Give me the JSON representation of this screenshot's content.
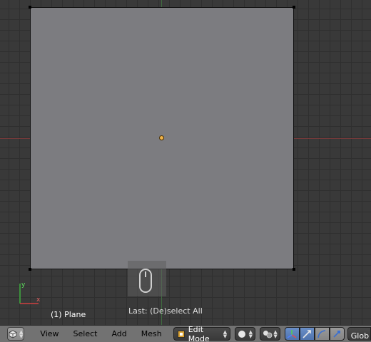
{
  "viewport": {
    "object_info": "(1) Plane",
    "last_operator": "Last: (De)select All",
    "nav_axis_x": "x",
    "nav_axis_y": "y"
  },
  "header": {
    "menus": [
      "View",
      "Select",
      "Add",
      "Mesh"
    ],
    "mode": "Edit Mode",
    "orientation": "Glob"
  },
  "colors": {
    "plane": "#7c7c80",
    "origin": "#f0b34a",
    "x_axis": "#c04040",
    "y_axis": "#40a040",
    "active_button": "#5a7fbc"
  },
  "icons": [
    "editor-type-icon",
    "mesh-mode-icon",
    "viewport-shading-icon",
    "pivot-icon",
    "transform-manipulator-icon",
    "translate-icon",
    "rotate-icon",
    "scale-icon",
    "mouse-icon"
  ]
}
